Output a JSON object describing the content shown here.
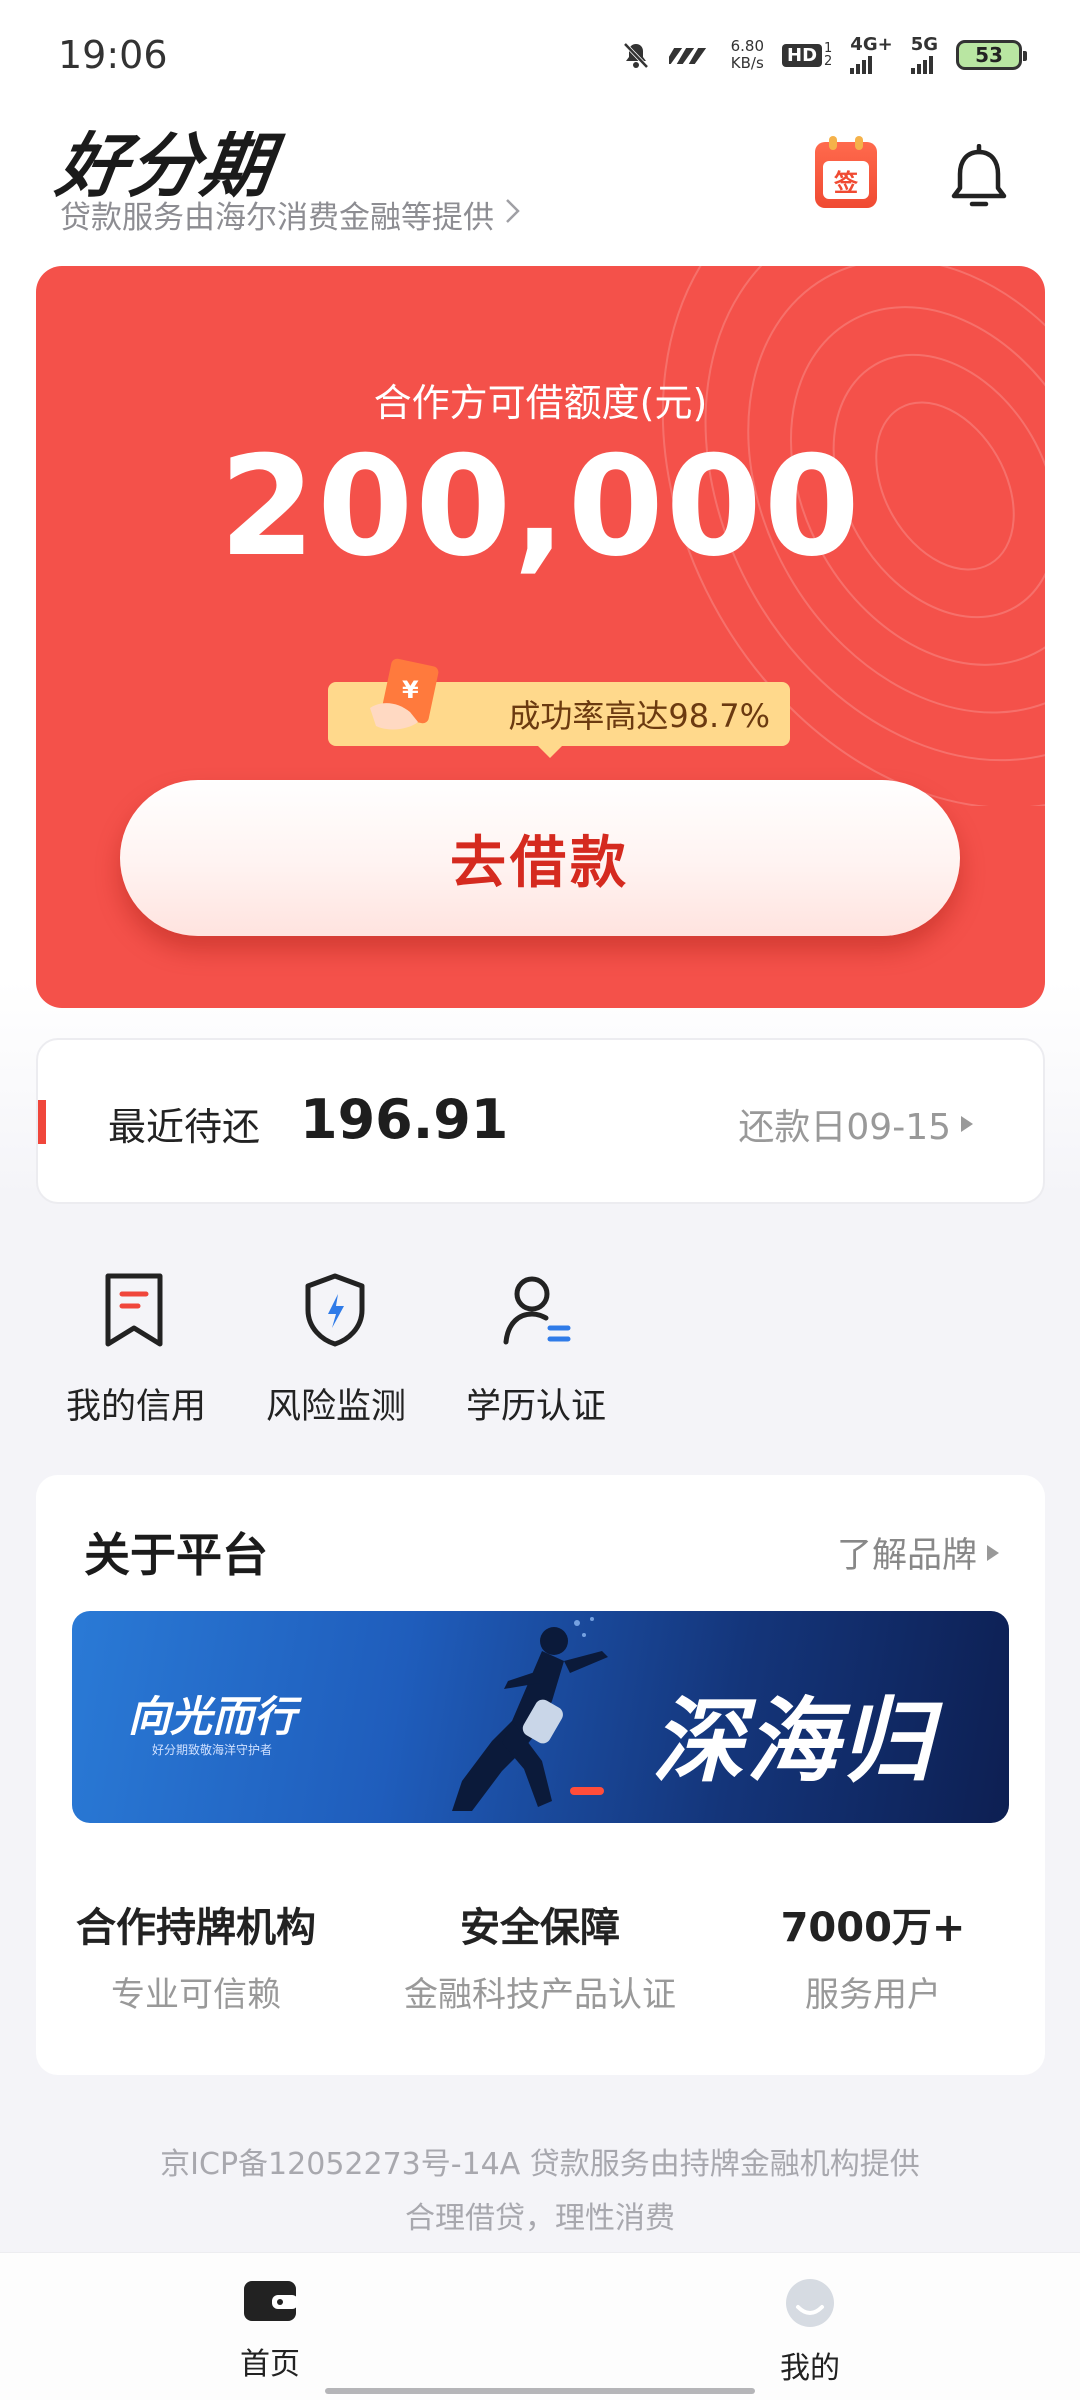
{
  "status_bar": {
    "time": "19:06",
    "net_speed_value": "6.80",
    "net_speed_unit": "KB/s",
    "hd_label": "HD",
    "hd_sub": "1",
    "hd_sub2": "2",
    "signal_1": "4G+",
    "signal_2": "5G",
    "battery": "53",
    "icons": [
      "mute-icon",
      "carrier-icon",
      "signal-icon",
      "battery-icon"
    ]
  },
  "header": {
    "logo": "好分期",
    "provider_text": "贷款服务由海尔消费金融等提供",
    "sign_label": "签",
    "icons": [
      "calendar-sign-icon",
      "bell-icon"
    ]
  },
  "credit_card": {
    "label": "合作方可借额度(元)",
    "amount": "200,000",
    "success_rate": "成功率高达98.7%",
    "coupon_symbol": "¥",
    "borrow_button": "去借款",
    "colors": {
      "card": "#f4514a",
      "button_text": "#d52a1f",
      "tag": "#ffd98c"
    }
  },
  "repayment": {
    "label": "最近待还",
    "amount": "196.91",
    "date": "还款日09-15"
  },
  "quick_actions": [
    {
      "label": "我的信用",
      "icon": "credit-bookmark-icon"
    },
    {
      "label": "风险监测",
      "icon": "risk-shield-icon"
    },
    {
      "label": "学历认证",
      "icon": "education-user-icon"
    }
  ],
  "about": {
    "title": "关于平台",
    "link": "了解品牌",
    "banner": {
      "left_text": "向光而行",
      "left_small": "好分期致敬海洋守护者",
      "right_text": "深海归途"
    },
    "features": [
      {
        "title": "合作持牌机构",
        "subtitle": "专业可信赖"
      },
      {
        "title": "安全保障",
        "subtitle": "金融科技产品认证"
      },
      {
        "title": "7000万+",
        "subtitle": "服务用户"
      }
    ]
  },
  "footer": {
    "line1": "京ICP备12052273号-14A 贷款服务由持牌金融机构提供",
    "line2": "合理借贷，理性消费"
  },
  "bottom_nav": [
    {
      "label": "首页",
      "icon": "wallet-home-icon",
      "active": true
    },
    {
      "label": "我的",
      "icon": "profile-face-icon",
      "active": false
    }
  ]
}
